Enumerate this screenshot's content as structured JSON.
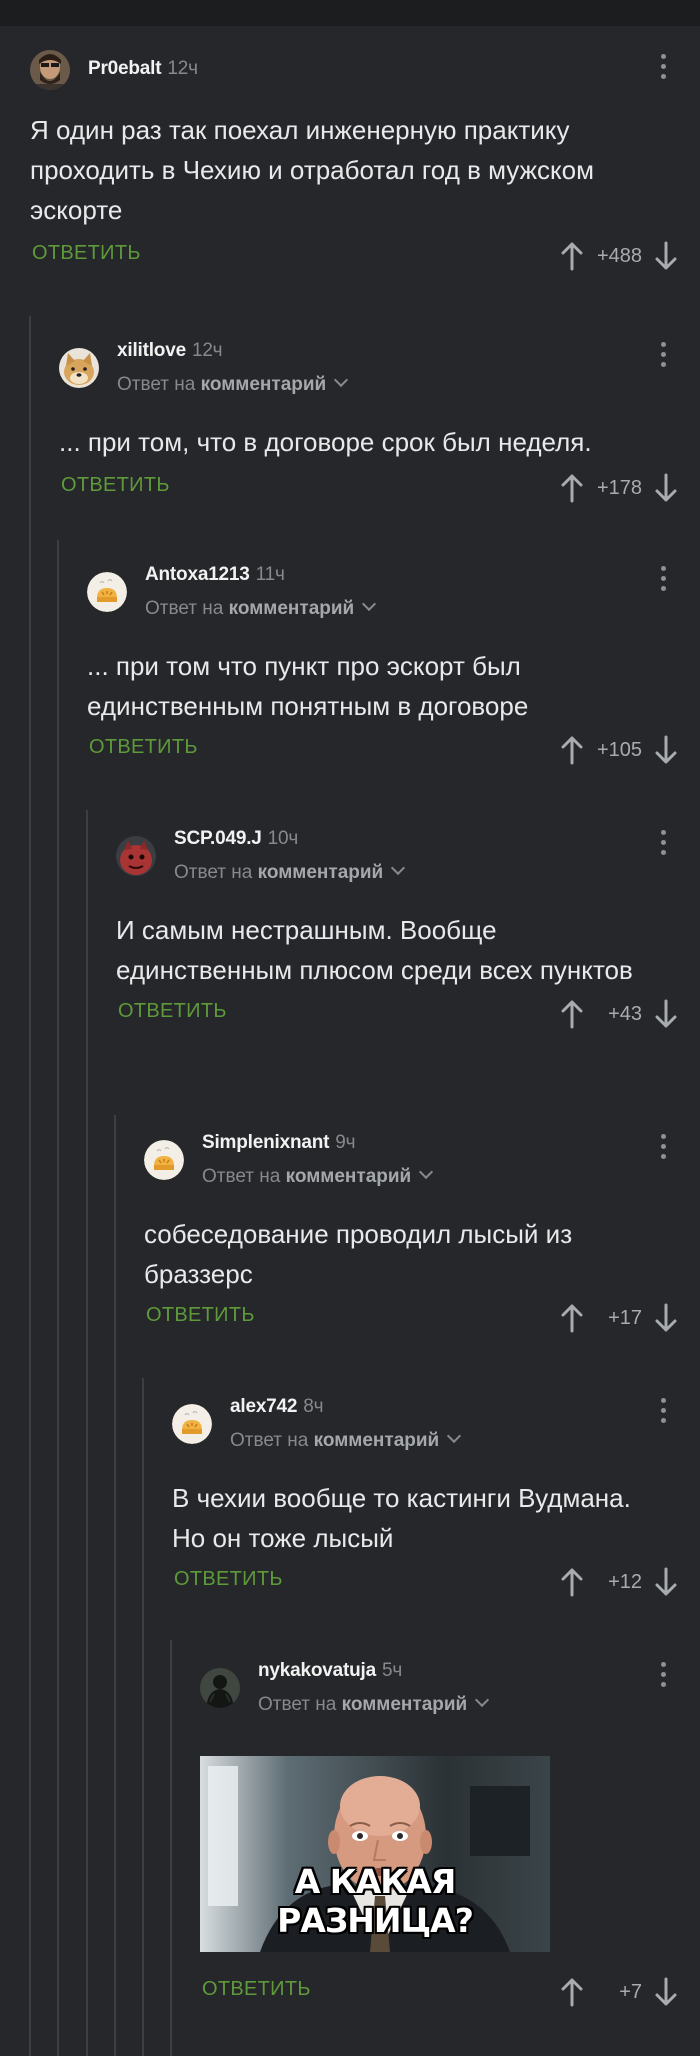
{
  "comments": [
    {
      "author": "Pr0ebalt",
      "time": "12ч",
      "text": "Я один раз так поехал инженерную практику проходить в Чехию и отработал год в мужском эскорте",
      "reply_label": "ОТВЕТИТЬ",
      "score": "+488",
      "avatar": "bearded-man-avatar"
    },
    {
      "author": "xilitlove",
      "time": "12ч",
      "reply_to_prefix": "Ответ на",
      "reply_to_target": "комментарий",
      "text": "... при том, что в договоре срок был неделя.",
      "reply_label": "ОТВЕТИТЬ",
      "score": "+178",
      "avatar": "doge-avatar"
    },
    {
      "author": "Antoxa1213",
      "time": "11ч",
      "reply_to_prefix": "Ответ на",
      "reply_to_target": "комментарий",
      "text": "... при том что пункт про эскорт был единственным понятным в договоре",
      "reply_label": "ОТВЕТИТЬ",
      "score": "+105",
      "avatar": "default-bread-avatar"
    },
    {
      "author": "SCP.049.J",
      "time": "10ч",
      "reply_to_prefix": "Ответ на",
      "reply_to_target": "комментарий",
      "text": "И самым нестрашным. Вообще единственным плюсом среди всех пунктов",
      "reply_label": "ОТВЕТИТЬ",
      "score": "+43",
      "avatar": "red-creature-avatar"
    },
    {
      "author": "Simplenixnant",
      "time": "9ч",
      "reply_to_prefix": "Ответ на",
      "reply_to_target": "комментарий",
      "text": "собеседование проводил лысый из браззерс",
      "reply_label": "ОТВЕТИТЬ",
      "score": "+17",
      "avatar": "default-bread-avatar"
    },
    {
      "author": "alex742",
      "time": "8ч",
      "reply_to_prefix": "Ответ на",
      "reply_to_target": "комментарий",
      "text": "В чехии вообще то кастинги Вудмана. Но он тоже лысый",
      "reply_label": "ОТВЕТИТЬ",
      "score": "+12",
      "avatar": "default-bread-avatar"
    },
    {
      "author": "nykakovatuja",
      "time": "5ч",
      "reply_to_prefix": "Ответ на",
      "reply_to_target": "комментарий",
      "meme_caption": "А КАКАЯ РАЗНИЦА?",
      "reply_label": "ОТВЕТИТЬ",
      "score": "+7",
      "avatar": "dark-figure-avatar"
    }
  ],
  "colors": {
    "background": "#25272a",
    "reply_button": "#5f9a3a",
    "author": "#f2f2f2",
    "muted": "#86898d"
  },
  "icons": [
    "more-vertical-icon",
    "arrow-up-icon",
    "arrow-down-icon",
    "chevron-down-icon"
  ]
}
